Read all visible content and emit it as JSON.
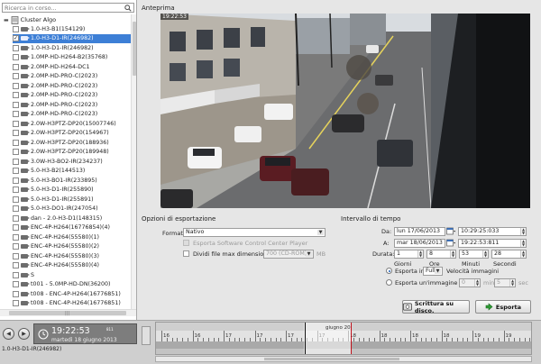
{
  "search": {
    "placeholder": "Ricerca in corso..."
  },
  "tree": {
    "root_label": "Cluster Algo",
    "items": [
      {
        "label": "1.0-H3-B1(154129)",
        "checked": false,
        "selected": false
      },
      {
        "label": "1.0-H3-D1-IR(246982)",
        "checked": true,
        "selected": true
      },
      {
        "label": "1.0-H3-D1-IR(246982)",
        "checked": false,
        "selected": false
      },
      {
        "label": "1.0MP-HD-H264-B2(35768)",
        "checked": false,
        "selected": false
      },
      {
        "label": "2.0MP-HD-H264-DC1",
        "checked": false,
        "selected": false
      },
      {
        "label": "2.0MP-HD-PRO-C(2023)",
        "checked": false,
        "selected": false
      },
      {
        "label": "2.0MP-HD-PRO-C(2023)",
        "checked": false,
        "selected": false
      },
      {
        "label": "2.0MP-HD-PRO-C(2023)",
        "checked": false,
        "selected": false
      },
      {
        "label": "2.0MP-HD-PRO-C(2023)",
        "checked": false,
        "selected": false
      },
      {
        "label": "2.0MP-HD-PRO-C(2023)",
        "checked": false,
        "selected": false
      },
      {
        "label": "2.0W-H3PTZ-DP20(15007746)",
        "checked": false,
        "selected": false
      },
      {
        "label": "2.0W-H3PTZ-DP20(154967)",
        "checked": false,
        "selected": false
      },
      {
        "label": "2.0W-H3PTZ-DP20(188936)",
        "checked": false,
        "selected": false
      },
      {
        "label": "2.0W-H3PTZ-DP20(189948)",
        "checked": false,
        "selected": false
      },
      {
        "label": "3.0W-H3-BO2-IR(234237)",
        "checked": false,
        "selected": false
      },
      {
        "label": "5.0-H3-B2(144513)",
        "checked": false,
        "selected": false
      },
      {
        "label": "5.0-H3-BO1-IR(233895)",
        "checked": false,
        "selected": false
      },
      {
        "label": "5.0-H3-D1-IR(255890)",
        "checked": false,
        "selected": false
      },
      {
        "label": "5.0-H3-D1-IR(255891)",
        "checked": false,
        "selected": false
      },
      {
        "label": "5.0-H3-DO1-IR(247054)",
        "checked": false,
        "selected": false
      },
      {
        "label": "dan - 2.0-H3-D1(148315)",
        "checked": false,
        "selected": false
      },
      {
        "label": "ENC-4P-H264(16776854)(4)",
        "checked": false,
        "selected": false
      },
      {
        "label": "ENC-4P-H264(55580)(1)",
        "checked": false,
        "selected": false
      },
      {
        "label": "ENC-4P-H264(55580)(2)",
        "checked": false,
        "selected": false
      },
      {
        "label": "ENC-4P-H264(55580)(3)",
        "checked": false,
        "selected": false
      },
      {
        "label": "ENC-4P-H264(55580)(4)",
        "checked": false,
        "selected": false
      },
      {
        "label": "S",
        "checked": false,
        "selected": false
      },
      {
        "label": "t001 - 5.0MP-HD-DN(36200)",
        "checked": false,
        "selected": false
      },
      {
        "label": "t008 - ENC-4P-H264(16776851)",
        "checked": false,
        "selected": false
      },
      {
        "label": "t008 - ENC-4P-H264(16776851)",
        "checked": false,
        "selected": false
      }
    ]
  },
  "preview": {
    "title": "Anteprima"
  },
  "export_options": {
    "title": "Opzioni di esportazione",
    "format_label": "Formato:",
    "format_value": "Nativo",
    "export_player_label": "Esporta Software Control Center Player",
    "split_label": "Dividi file max dimensioni di:",
    "split_value": "700 (CD-ROM)",
    "split_unit": "MB"
  },
  "interval": {
    "title": "Intervallo di tempo",
    "from_label": "Da:",
    "from_date": "lun 17/06/2013",
    "from_time": "10:29:25:033",
    "to_label": "A:",
    "to_date": "mar 18/06/2013",
    "to_time": "19:22:53:811",
    "duration_label": "Durata:",
    "duration": {
      "days": "1",
      "hours": "8",
      "minutes": "53",
      "seconds": "28"
    },
    "col_days": "Giorni",
    "col_hours": "Ore",
    "col_minutes": "Minuti",
    "col_seconds": "Secondi",
    "export_in_label": "Esporta in",
    "export_in_value": "Full",
    "speed_label": "Velocità immagini",
    "one_image_label": "Esporta un'immagine ogni",
    "min_value": "0",
    "min_unit": "min",
    "sec_value": "5",
    "sec_unit": "sec"
  },
  "buttons": {
    "disk_label": "Scrittura su disco.",
    "export_label": "Esporta"
  },
  "player": {
    "time": "19:22:53",
    "time_suffix": "811",
    "date": "martedì 18 giugno 2013",
    "camera": "1.0-H3-D1-IR(246982)"
  },
  "timeline": {
    "month_label": "giugno 20",
    "numbers": [
      "16",
      "16",
      "17",
      "17",
      "17",
      "17",
      "18",
      "18",
      "18",
      "18",
      "19",
      "19"
    ]
  },
  "colors": {
    "selection": "#3d7fd6",
    "export_green": "#2e9a34",
    "playhead": "#c0101a"
  }
}
